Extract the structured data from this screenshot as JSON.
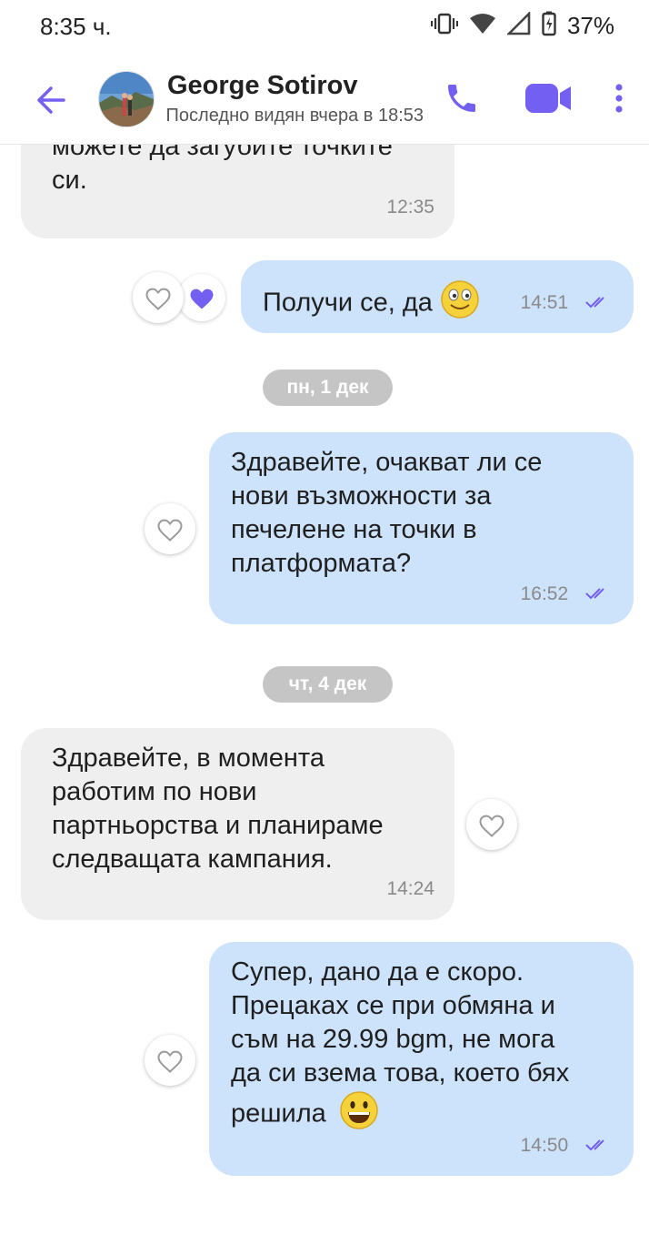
{
  "status_bar": {
    "time": "8:35 ч.",
    "battery": "37%"
  },
  "header": {
    "contact_name": "George Sotirov",
    "last_seen": "Последно видян вчера в 18:53"
  },
  "messages": [
    {
      "direction": "incoming",
      "text": "можете да загубите точките\nси.",
      "time": "12:35"
    },
    {
      "direction": "outgoing",
      "text": "Получи се, да",
      "emoji": "slightly-smiling-face",
      "time": "14:51",
      "reaction": "liked"
    },
    {
      "date_separator": "пн, 1 дек"
    },
    {
      "direction": "outgoing",
      "text": "Здравейте, очакват ли се\nнови възможности за\nпечелене на точки в\nплатформата?",
      "time": "16:52"
    },
    {
      "date_separator": "чт, 4 дек"
    },
    {
      "direction": "incoming",
      "text": "Здравейте, в момента\nработим по нови\nпартньорства и планираме\nследващата кампания.",
      "time": "14:24"
    },
    {
      "direction": "outgoing",
      "text": "Супер, дано да е скоро.\nПрецаках се при обмяна и\nсъм на 29.99 bgm, не мога\nда си взема това, което бях\nрешила",
      "emoji": "grinning-face",
      "time": "14:50"
    }
  ],
  "date_chips": [
    "пн, 1 дек",
    "чт, 4 дек"
  ],
  "colors": {
    "accent": "#7360f2",
    "incoming_bubble": "#efefef",
    "outgoing_bubble": "#cde2fb",
    "date_chip": "#c5c5c5"
  }
}
